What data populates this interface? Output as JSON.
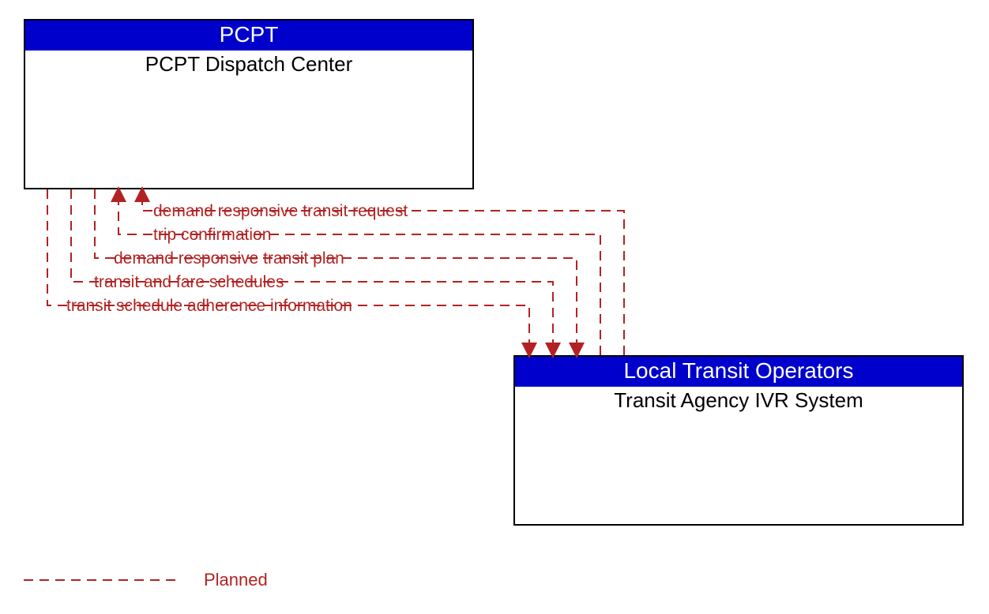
{
  "boxes": {
    "pcpt": {
      "header": "PCPT",
      "title": "PCPT Dispatch Center"
    },
    "ivr": {
      "header": "Local Transit Operators",
      "title": "Transit Agency IVR System"
    }
  },
  "flows": {
    "f1": "demand responsive transit request",
    "f2": "trip confirmation",
    "f3": "demand responsive transit plan",
    "f4": "transit and fare schedules",
    "f5": "transit schedule adherence information"
  },
  "legend": {
    "planned": "Planned"
  }
}
